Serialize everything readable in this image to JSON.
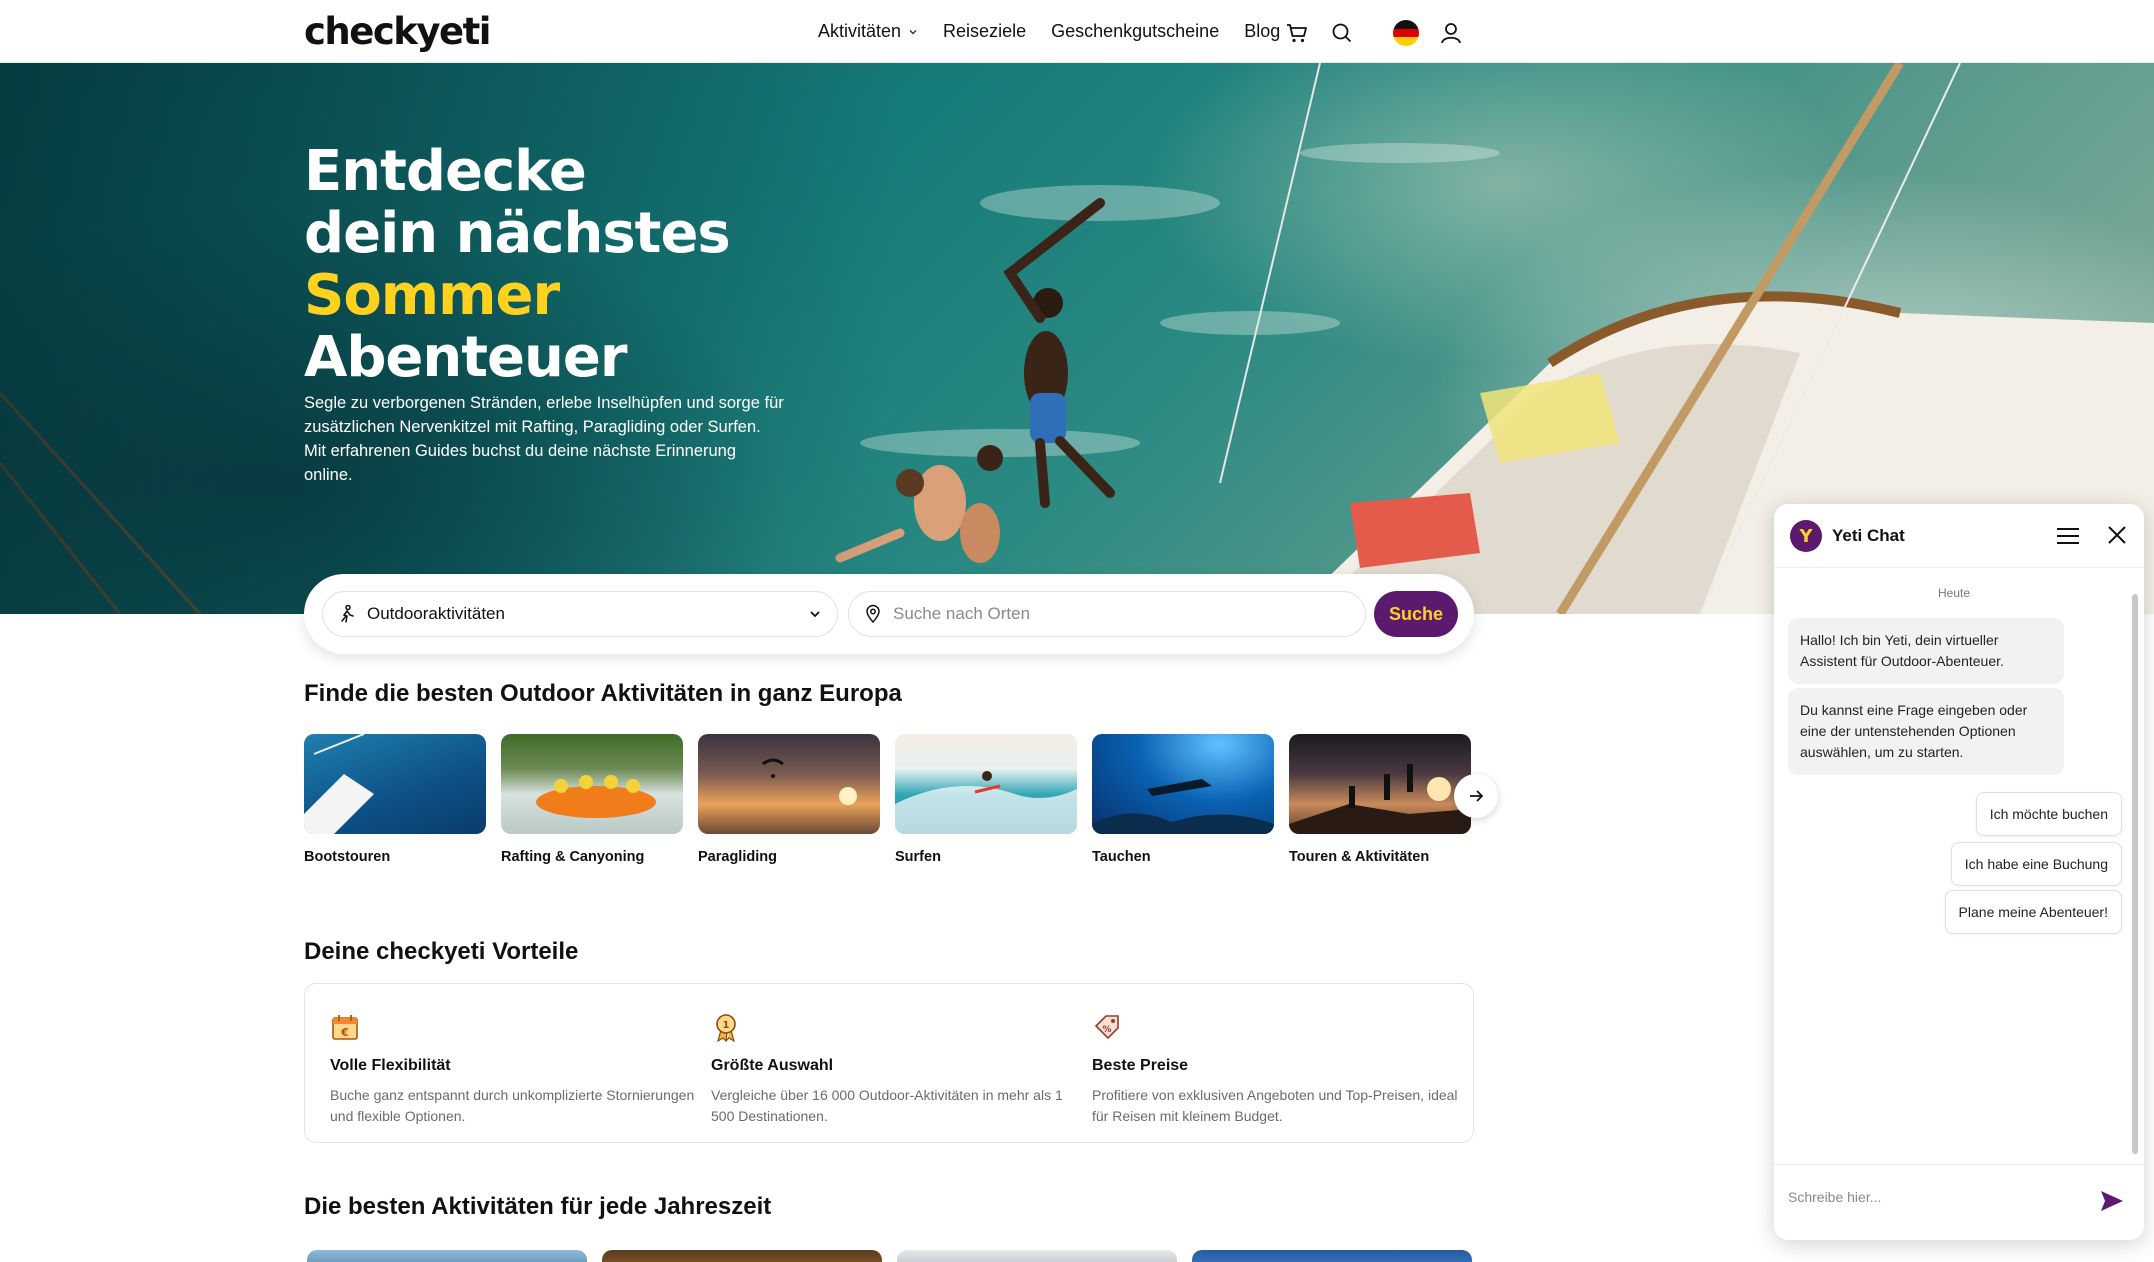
{
  "header": {
    "logo": "checkyeti",
    "nav": [
      {
        "label": "Aktivitäten",
        "has_dropdown": true
      },
      {
        "label": "Reiseziele"
      },
      {
        "label": "Geschenkgutscheine"
      },
      {
        "label": "Blog"
      }
    ],
    "icons": [
      "cart-icon",
      "search-icon",
      "flag-de-icon",
      "user-icon"
    ]
  },
  "hero": {
    "title_line1": "Entdecke",
    "title_line2": "dein nächstes",
    "title_accent": "Sommer",
    "title_line4": "Abenteuer",
    "subtitle": "Segle zu verborgenen Stränden, erlebe Inselhüpfen und sorge für zusätzlichen Nervenkitzel mit Rafting, Paragliding oder Surfen. Mit erfahrenen Guides buchst du deine nächste Erinnerung online."
  },
  "search": {
    "activity_value": "Outdooraktivitäten",
    "location_placeholder": "Suche nach Orten",
    "button_label": "Suche"
  },
  "categories": {
    "title": "Finde die besten Outdoor Aktivitäten in ganz Europa",
    "items": [
      {
        "label": "Bootstouren"
      },
      {
        "label": "Rafting & Canyoning"
      },
      {
        "label": "Paragliding"
      },
      {
        "label": "Surfen"
      },
      {
        "label": "Tauchen"
      },
      {
        "label": "Touren & Aktivitäten"
      }
    ]
  },
  "benefits": {
    "title": "Deine checkyeti Vorteile",
    "items": [
      {
        "title": "Volle Flexibilität",
        "desc": "Buche ganz entspannt durch unkomplizierte Stornierungen und flexible Optionen.",
        "icon": "calendar-euro-icon"
      },
      {
        "title": "Größte Auswahl",
        "desc": "Vergleiche über 16 000 Outdoor-Aktivitäten in mehr als 1 500 Destinationen.",
        "icon": "medal-icon"
      },
      {
        "title": "Beste Preise",
        "desc": "Profitiere von exklusiven Angeboten und Top-Preisen, ideal für Reisen mit kleinem Budget.",
        "icon": "price-tag-icon"
      }
    ]
  },
  "seasons": {
    "title": "Die besten Aktivitäten für jede Jahreszeit"
  },
  "chat": {
    "avatar_letter": "Y",
    "title": "Yeti Chat",
    "day_label": "Heute",
    "messages": [
      "Hallo! Ich bin Yeti, dein virtueller Assistent für Outdoor-Abenteuer.",
      "Du kannst eine Frage eingeben oder eine der untenstehenden Optionen auswählen, um zu starten."
    ],
    "quick_replies": [
      "Ich möchte buchen",
      "Ich habe eine Buchung",
      "Plane meine Abenteuer!"
    ],
    "input_placeholder": "Schreibe hier..."
  },
  "colors": {
    "brand_purple": "#5b1a6e",
    "accent_yellow": "#ffd21f"
  }
}
